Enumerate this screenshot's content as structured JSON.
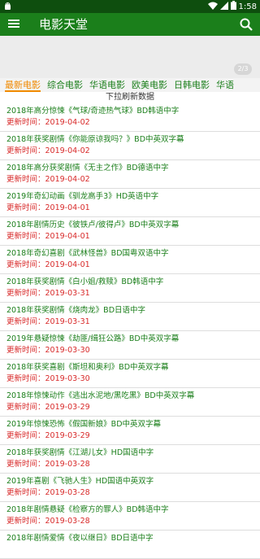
{
  "status_bar": {
    "time": "1:58"
  },
  "app_bar": {
    "title": "电影天堂"
  },
  "banner": {
    "page_indicator": "2/3"
  },
  "tabs": [
    "最新电影",
    "综合电影",
    "华语电影",
    "欧美电影",
    "日韩电影",
    "华语"
  ],
  "refresh_text": "下拉刷新数据",
  "date_prefix": "更新时间：",
  "items": [
    {
      "title": "2018年高分惊悚《气球/奇迹热气球》BD韩语中字",
      "date": "更新时间：2019-04-02"
    },
    {
      "title": "2018年获奖剧情《你能原谅我吗？》BD中英双字幕",
      "date": "更新时间：2019-04-02"
    },
    {
      "title": "2018年高分获奖剧情《无主之作》BD德语中字",
      "date": "更新时间：2019-04-02"
    },
    {
      "title": "2019年奇幻动画《驯龙高手3》HD英语中字",
      "date": "更新时间：2019-04-01"
    },
    {
      "title": "2018年剧情历史《彼铁卢/彼得卢》BD中英双字幕",
      "date": "更新时间：2019-04-01"
    },
    {
      "title": "2018年奇幻喜剧《武林怪兽》BD国粤双语中字",
      "date": "更新时间：2019-04-01"
    },
    {
      "title": "2018年获奖剧情《白小姐/救赎》BD韩语中字",
      "date": "更新时间：2019-03-31"
    },
    {
      "title": "2018年获奖剧情《烧肉龙》BD日语中字",
      "date": "更新时间：2019-03-31"
    },
    {
      "title": "2019年悬疑惊悚《劫匪/缉狂公路》BD中英双字幕",
      "date": "更新时间：2019-03-30"
    },
    {
      "title": "2018年获奖喜剧《斯坦和奥利》BD中英双字幕",
      "date": "更新时间：2019-03-30"
    },
    {
      "title": "2018年惊悚动作《逃出水泥地/黑吃黑》BD中英双字幕",
      "date": "更新时间：2019-03-29"
    },
    {
      "title": "2019年惊悚恐怖《假国新娘》BD中英双字幕",
      "date": "更新时间：2019-03-29"
    },
    {
      "title": "2018年获奖剧情《江湖儿女》HD国语中字",
      "date": "更新时间：2019-03-28"
    },
    {
      "title": "2019年喜剧《飞驰人生》HD国语中英双字",
      "date": "更新时间：2019-03-28"
    },
    {
      "title": "2018年剧情悬疑《检察方的罪人》BD韩语中字",
      "date": "更新时间：2019-03-28"
    },
    {
      "title": "2018年剧情爱情《夜以继日》BD日语中字",
      "date": ""
    }
  ],
  "colors": {
    "primary": "#1b7f1b",
    "status_bar": "#0e4e0e",
    "active_tab": "#f08a00",
    "date": "#d82a2a"
  },
  "icons": {
    "menu": "hamburger-icon",
    "search": "search-icon",
    "wifi": "wifi-icon",
    "signal": "signal-icon",
    "battery": "battery-icon",
    "app": "android-icon"
  }
}
